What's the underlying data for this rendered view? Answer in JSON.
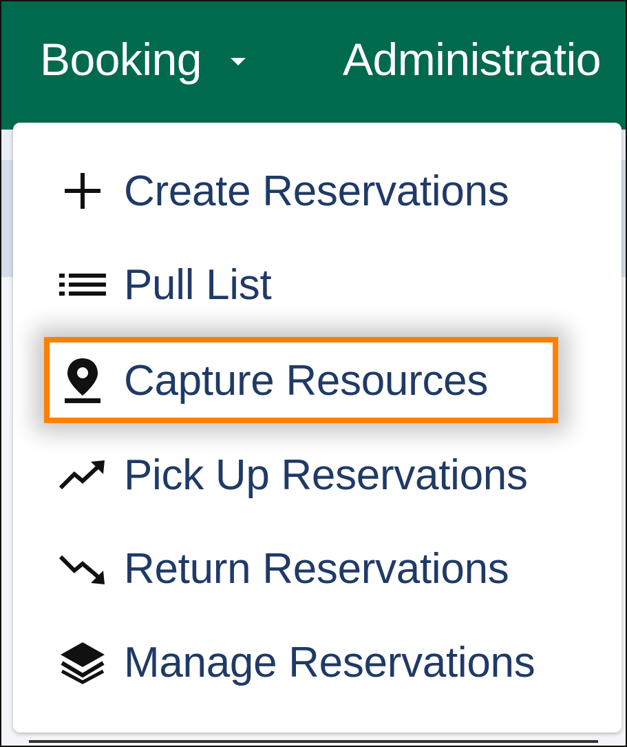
{
  "navbar": {
    "booking_label": "Booking",
    "administration_label": "Administratio",
    "background_color": "#006a4e"
  },
  "dropdown": {
    "items": [
      {
        "label": "Create Reservations",
        "icon": "plus-icon"
      },
      {
        "label": "Pull List",
        "icon": "list-icon"
      },
      {
        "label": "Capture Resources",
        "icon": "map-pin-icon",
        "highlighted": true
      },
      {
        "label": "Pick Up Reservations",
        "icon": "trend-up-icon"
      },
      {
        "label": "Return Reservations",
        "icon": "trend-down-icon"
      },
      {
        "label": "Manage Reservations",
        "icon": "layers-icon"
      }
    ],
    "text_color": "#1f3a66",
    "highlight_color": "#ff7f00"
  }
}
